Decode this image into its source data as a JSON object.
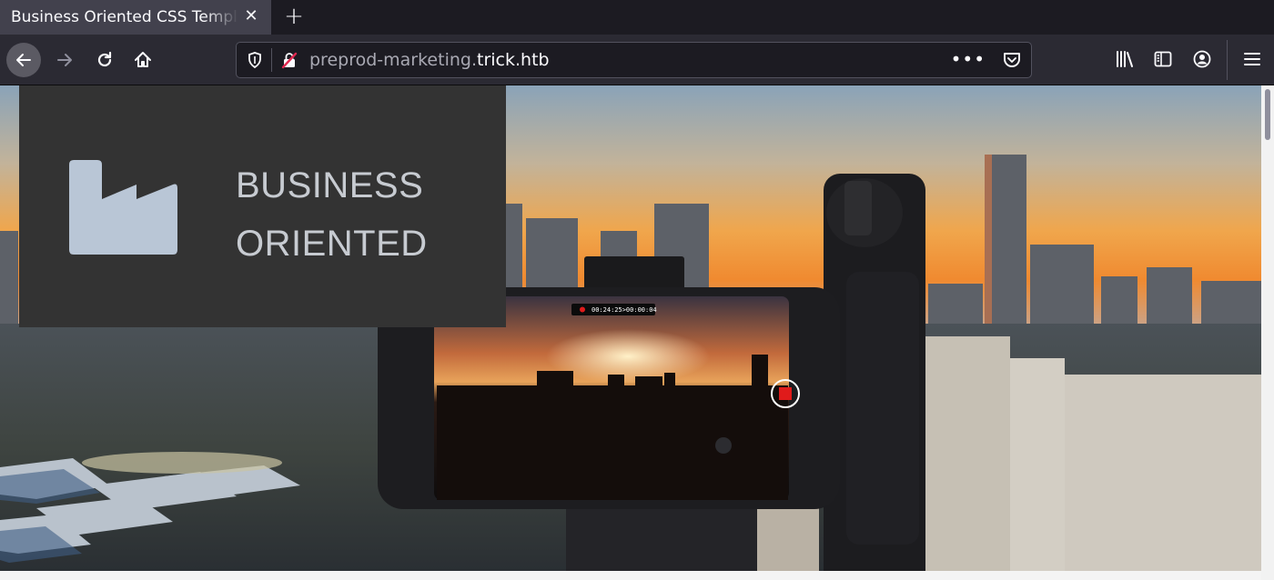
{
  "browser": {
    "tab": {
      "title": "Business Oriented CSS Template",
      "close_icon": "close-icon"
    },
    "new_tab_icon": "plus-icon",
    "nav": {
      "back_icon": "back-arrow-icon",
      "forward_icon": "forward-arrow-icon",
      "reload_icon": "reload-icon",
      "home_icon": "home-icon"
    },
    "url": {
      "prefix": "preprod-marketing.",
      "domain": "trick.htb",
      "more": "•••",
      "shield_icon": "tracking-shield-icon",
      "insecure_icon": "insecure-lock-icon",
      "pocket_icon": "pocket-icon"
    },
    "toolbar": {
      "library_icon": "library-icon",
      "sidebar_icon": "sidebar-icon",
      "account_icon": "account-icon",
      "menu_icon": "hamburger-menu-icon"
    }
  },
  "page": {
    "brand": {
      "logo_icon": "factory-icon",
      "line1": "BUSINESS",
      "line2": "ORIENTED"
    },
    "hero": {
      "recording_overlay": "00:24:25>00:00:04",
      "description": "city skyline at sunset with phone on gimbal"
    }
  },
  "colors": {
    "tab_strip": "#1c1b22",
    "toolbar": "#2b2a33",
    "brand_box": "#333333",
    "brand_text": "#c7cbd1",
    "logo": "#b9c6d6"
  }
}
